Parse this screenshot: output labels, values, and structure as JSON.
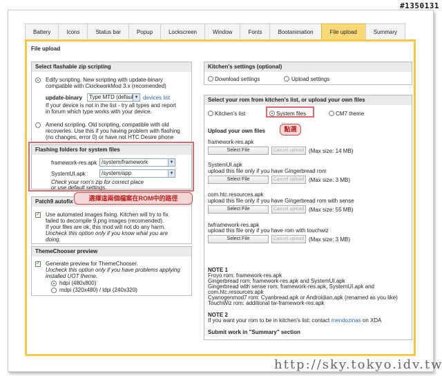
{
  "watermark": {
    "id": "#1350131",
    "url": "http://sky.tokyo.idv.tw"
  },
  "tabs": [
    {
      "label": "Battery"
    },
    {
      "label": "Icons"
    },
    {
      "label": "Status bar"
    },
    {
      "label": "Popup"
    },
    {
      "label": "Lockscreen"
    },
    {
      "label": "Window"
    },
    {
      "label": "Fonts"
    },
    {
      "label": "Bootanimation"
    },
    {
      "label": "File upload",
      "active": true
    },
    {
      "label": "Summary"
    }
  ],
  "panel_title": "File upload",
  "zip": {
    "title": "Select flashable zip scripting",
    "opt1_line1": "Edify scripting. New scripting with update-binary",
    "opt1_line2": "compatible with ClockworkMod 3.x (recomended)",
    "binary_label": "update-binary",
    "binary_value": "Type MTD (default)",
    "devices_link": "devices list",
    "opt1_note1": "If your device is not in the list - try all types and report",
    "opt1_note2": "in forum which type works with your device.",
    "opt2_line1": "Amend scripting. Old scripting, compatible with old",
    "opt2_line2": "recoveries. Use this if you having problem with flashing",
    "opt2_line3": "(no changes, error 0) or have not HTC Desire phone"
  },
  "flash": {
    "title": "Flashing folders for system files",
    "row1_label": "framework-res.apk",
    "row1_value": "/system/framework",
    "row2_label": "SystemUI.apk",
    "row2_value": "/system/app",
    "note1": "Check your rom's zip for correct place",
    "note2": "or use default settings."
  },
  "callout_left": "選擇這兩個檔案在ROM中的路徑",
  "patch9": {
    "title": "Patch9 autofix",
    "line1": "Use automated images fixing. Kitchen will try to fix",
    "line2": "failed to decompile 9.png images (recomended).",
    "line3": "If your files are ok, this mod will not do any harm.",
    "line4": "Uncheck this option only if you know what you are",
    "line5": "doing."
  },
  "theme": {
    "title": "ThemeChooser preview",
    "line1": "Generate preview for ThemeChooser.",
    "line2": "Uncheck this option only if you have problems applying",
    "line3": "installed UOT theme.",
    "opt1": "hdpi (480x800)",
    "opt2": "mdpi (320x480) / ldpi (240x320)"
  },
  "kitchen": {
    "title": "Kitchen's settings (optional)",
    "opt1": "Download settings",
    "opt2": "Upload settings"
  },
  "rom": {
    "title": "Select your rom from kitchen's list, or upload your own files",
    "opt1": "Kitchen's list",
    "opt2": "System files",
    "opt3": "CM7 theme"
  },
  "callout_right": "點選",
  "upload": {
    "title": "Upload your own files",
    "select_label": "Select File",
    "cancel_label": "Cancel upload",
    "files": [
      {
        "name": "framework-res.apk",
        "note": "",
        "max": "(Max size: 14 MB)"
      },
      {
        "name": "SystemUI.apk",
        "note": "upload this file only if you have Gingerbread rom",
        "max": "(Max size: 3 MB)"
      },
      {
        "name": "com.htc.resources.apk",
        "note": "upload this file only if you have Gingerbread rom with sense",
        "max": "(Max size: 55 MB)"
      },
      {
        "name": "twframework-res.apk",
        "note": "upload this file only if you have rom with touchwiz",
        "max": "(Max size: 3 MB)"
      }
    ]
  },
  "notes": {
    "n1_title": "NOTE 1",
    "n1_l1": "Froyo rom: framework-res.apk",
    "n1_l2": "Gingerbread rom: framework-res.apk and SystemUI.apk",
    "n1_l3": "Gingerbread with sense rom: framework-res.apk, SystemUI.apk and",
    "n1_l4": "com.htc.resources.apk",
    "n1_l5": "Cyanogenmod7 rom: Cyanbread.apk or Androidian.apk (renamed as you like)",
    "n1_l6": "TouchWiz rom: additional tw-framework-res.apk",
    "n2_title": "NOTE 2",
    "n2_pre": "If you want your rom to be in kitchen's list: contact",
    "n2_link": "mendozinas",
    "n2_post": "on XDA",
    "submit": "Submit work in \"Summary\" section"
  }
}
